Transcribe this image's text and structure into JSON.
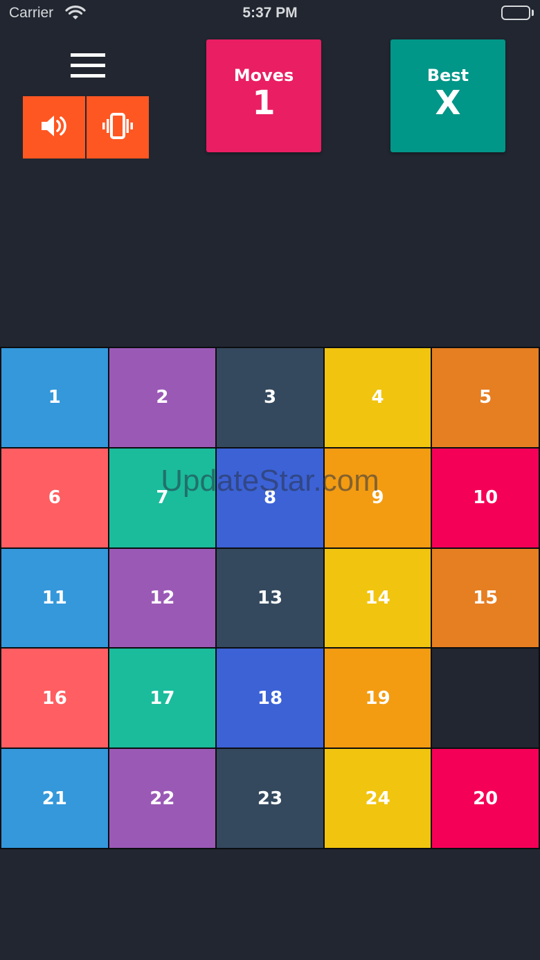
{
  "status_bar": {
    "carrier": "Carrier",
    "time": "5:37 PM"
  },
  "controls": {
    "menu_icon": "hamburger-menu-icon",
    "sound_icon": "speaker-icon",
    "vibrate_icon": "vibration-icon",
    "accent_color": "#ff5722"
  },
  "scores": {
    "moves_label": "Moves",
    "moves_value": "1",
    "moves_color": "#e91e63",
    "best_label": "Best",
    "best_value": "X",
    "best_color": "#009688"
  },
  "board": {
    "rows": 5,
    "cols": 5,
    "tiles": [
      {
        "label": "1",
        "color": "#3498db"
      },
      {
        "label": "2",
        "color": "#9b59b6"
      },
      {
        "label": "3",
        "color": "#34495e"
      },
      {
        "label": "4",
        "color": "#f1c40f"
      },
      {
        "label": "5",
        "color": "#e67e22"
      },
      {
        "label": "6",
        "color": "#ff5e62"
      },
      {
        "label": "7",
        "color": "#1abc9c"
      },
      {
        "label": "8",
        "color": "#3c62d6"
      },
      {
        "label": "9",
        "color": "#f39c12"
      },
      {
        "label": "10",
        "color": "#f50057"
      },
      {
        "label": "11",
        "color": "#3498db"
      },
      {
        "label": "12",
        "color": "#9b59b6"
      },
      {
        "label": "13",
        "color": "#34495e"
      },
      {
        "label": "14",
        "color": "#f1c40f"
      },
      {
        "label": "15",
        "color": "#e67e22"
      },
      {
        "label": "16",
        "color": "#ff5e62"
      },
      {
        "label": "17",
        "color": "#1abc9c"
      },
      {
        "label": "18",
        "color": "#3c62d6"
      },
      {
        "label": "19",
        "color": "#f39c12"
      },
      {
        "label": "",
        "color": "#212630",
        "empty": true
      },
      {
        "label": "21",
        "color": "#3498db"
      },
      {
        "label": "22",
        "color": "#9b59b6"
      },
      {
        "label": "23",
        "color": "#34495e"
      },
      {
        "label": "24",
        "color": "#f1c40f"
      },
      {
        "label": "20",
        "color": "#f50057"
      }
    ]
  },
  "watermark": "UpdateStar.com"
}
